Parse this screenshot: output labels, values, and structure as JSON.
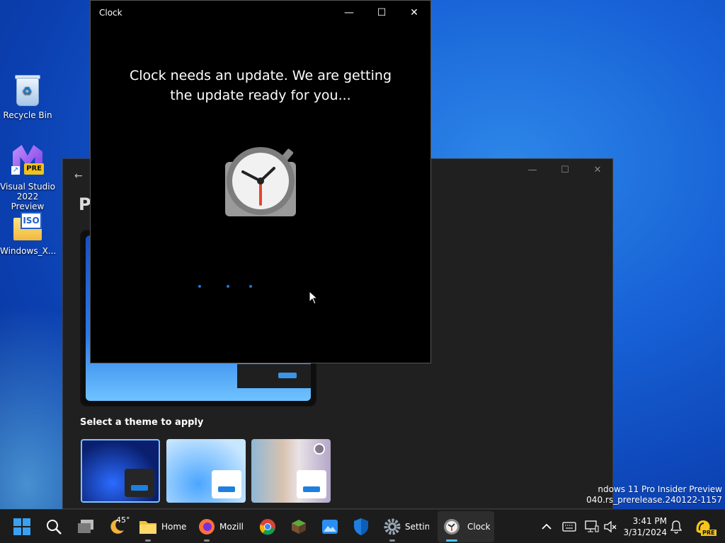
{
  "desktop": {
    "icons": [
      {
        "label": "Recycle Bin"
      },
      {
        "label": "Visual Studio 2022 Preview",
        "badge": "PRE"
      },
      {
        "label": "Windows_X...",
        "badge": "ISO"
      }
    ]
  },
  "settings_window": {
    "title_partial": "P",
    "section_label": "Select a theme to apply"
  },
  "clock_window": {
    "title": "Clock",
    "message": "Clock needs an update. We are getting the update ready for you..."
  },
  "watermark": {
    "line1": "ndows 11 Pro Insider Preview",
    "line2": "040.rs_prerelease.240122-1157"
  },
  "taskbar": {
    "weather_temp": "45°",
    "items": [
      {
        "label": "Home"
      },
      {
        "label": "Mozill"
      },
      {
        "label": "Settin"
      },
      {
        "label": "Clock"
      }
    ],
    "time": "3:41 PM",
    "date": "3/31/2024",
    "copilot_badge": "PRE"
  },
  "colors": {
    "accent": "#4cc2ff",
    "clock_red": "#e8452b"
  }
}
